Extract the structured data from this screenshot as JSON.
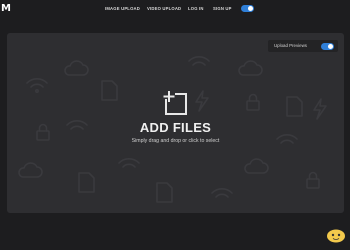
{
  "logo": {
    "mark": "M"
  },
  "nav": {
    "items": [
      {
        "label": "IMAGE UPLOAD"
      },
      {
        "label": "VIDEO UPLOAD"
      },
      {
        "label": "LOG IN"
      },
      {
        "label": "SIGN UP"
      }
    ],
    "theme_toggle_on": true
  },
  "dropzone": {
    "preview_label": "Upload Previews",
    "preview_toggle_on": true,
    "title": "ADD FILES",
    "subtitle": "Simply drag and drop or click to select"
  },
  "colors": {
    "accent": "#2f7fd8",
    "page_bg": "#1d1d1f",
    "panel_bg": "#2e2e31"
  },
  "icons": [
    "upload-icon",
    "theme-toggle",
    "wifi-icon",
    "cloud-icon",
    "lock-icon",
    "bolt-icon",
    "file-icon"
  ]
}
